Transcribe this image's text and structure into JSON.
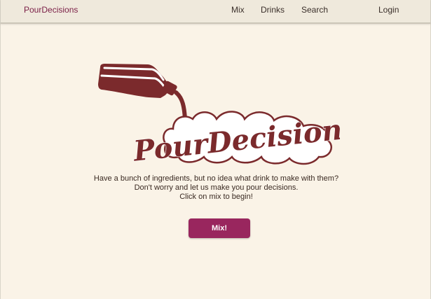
{
  "nav": {
    "brand": "PourDecisions",
    "items": [
      "Mix",
      "Drinks",
      "Search"
    ],
    "login": "Login"
  },
  "logo": {
    "text": "PourDecisions"
  },
  "hero": {
    "lines": [
      "Have a bunch of ingredients, but no idea what drink to make with them?",
      "Don't worry and let us make you pour decisions.",
      "Click on mix to begin!"
    ],
    "button": "Mix!"
  },
  "colors": {
    "background": "#faf3e7",
    "navbar": "#efe9dc",
    "brand": "#7a1e46",
    "logo": "#7b2a2c",
    "button": "#99265e"
  }
}
